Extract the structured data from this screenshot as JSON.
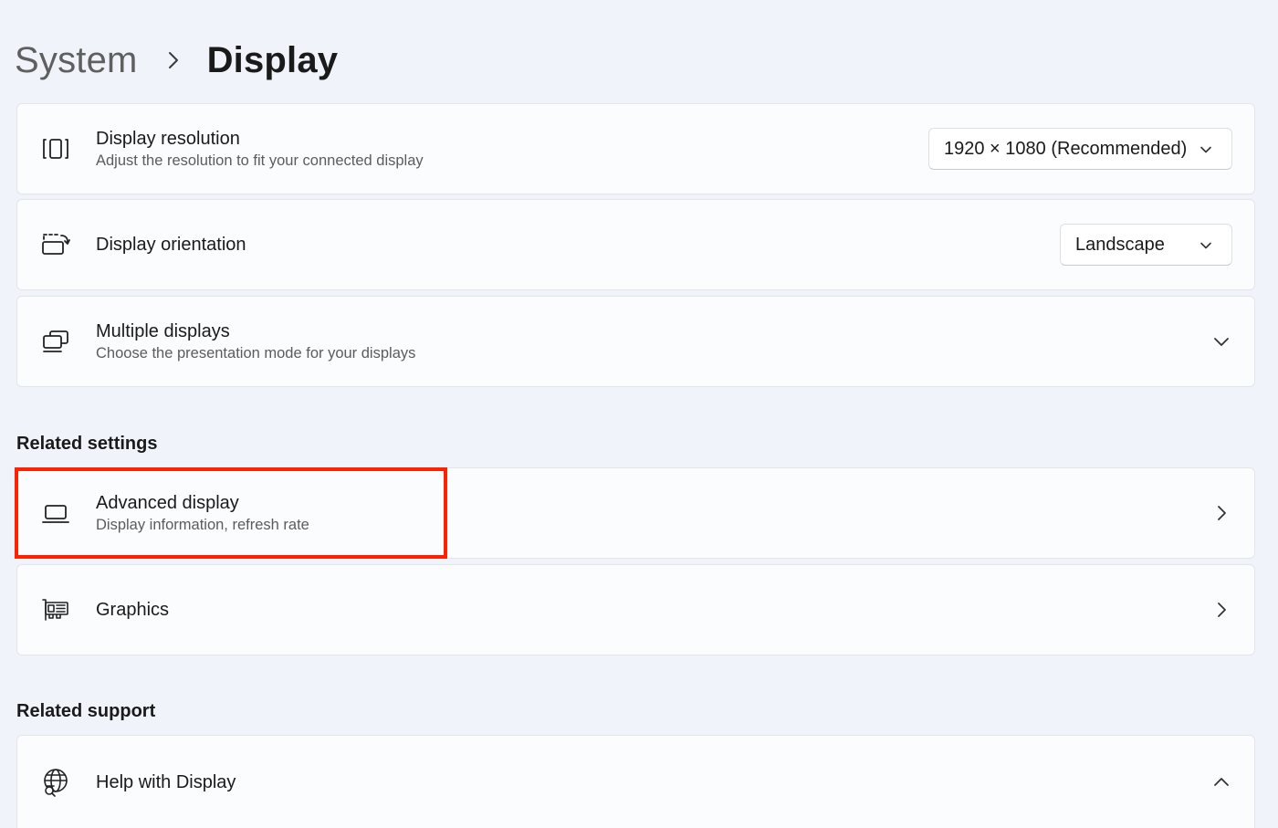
{
  "breadcrumb": {
    "parent": "System",
    "current": "Display"
  },
  "cards": {
    "resolution": {
      "title": "Display resolution",
      "subtitle": "Adjust the resolution to fit your connected display",
      "value": "1920 × 1080 (Recommended)",
      "icon": "resolution-icon"
    },
    "orientation": {
      "title": "Display orientation",
      "value": "Landscape",
      "icon": "orientation-icon"
    },
    "multiple": {
      "title": "Multiple displays",
      "subtitle": "Choose the presentation mode for your displays",
      "icon": "multiple-displays-icon"
    },
    "advanced": {
      "title": "Advanced display",
      "subtitle": "Display information, refresh rate",
      "icon": "laptop-icon"
    },
    "graphics": {
      "title": "Graphics",
      "icon": "graphics-card-icon"
    },
    "help": {
      "title": "Help with Display",
      "icon": "globe-search-icon"
    }
  },
  "sections": {
    "related_settings": "Related settings",
    "related_support": "Related support"
  },
  "colors": {
    "background": "#f0f4fa",
    "card": "#fbfcfe",
    "highlight": "#ff2200"
  }
}
